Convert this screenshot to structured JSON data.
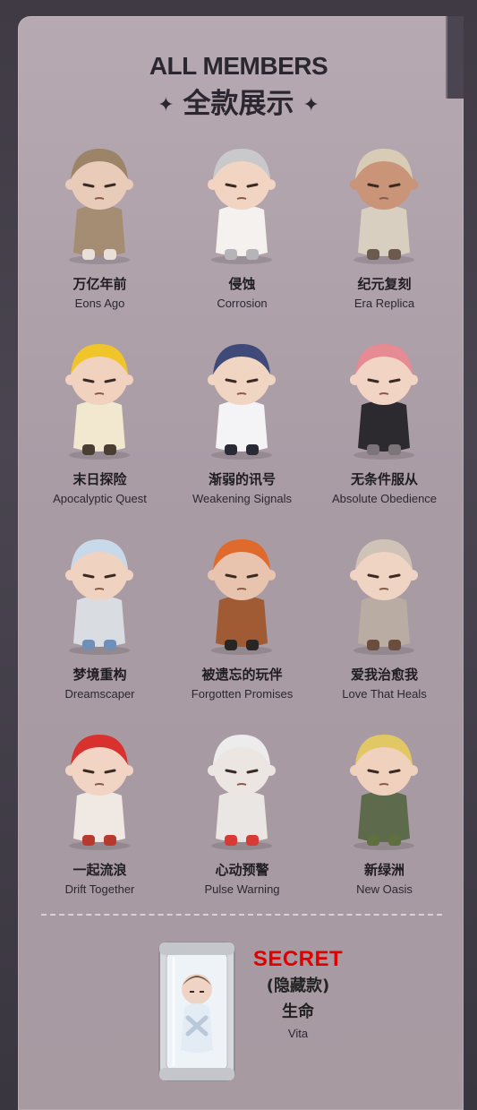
{
  "header": {
    "title_en": "ALL MEMBERS",
    "title_cn": "全款展示",
    "spark": "✦"
  },
  "members": [
    {
      "cn": "万亿年前",
      "en": "Eons Ago",
      "hair": "#9b8468",
      "skin": "#e8cbb8",
      "outfit": "#a58d73",
      "accent": "#e8e0d8"
    },
    {
      "cn": "侵蚀",
      "en": "Corrosion",
      "hair": "#c9c9cc",
      "skin": "#f1d4c2",
      "outfit": "#f4f1ee",
      "accent": "#b5b5b8"
    },
    {
      "cn": "纪元复刻",
      "en": "Era Replica",
      "hair": "#d8ccb6",
      "skin": "#c99477",
      "outfit": "#d9cfc0",
      "accent": "#6c5a4f"
    },
    {
      "cn": "末日探险",
      "en": "Apocalyptic Quest",
      "hair": "#f0c52a",
      "skin": "#f0d2bf",
      "outfit": "#f2e7cf",
      "accent": "#4a3d32"
    },
    {
      "cn": "渐弱的讯号",
      "en": "Weakening Signals",
      "hair": "#3f4a78",
      "skin": "#f0d5c3",
      "outfit": "#f4f4f6",
      "accent": "#2a2a34"
    },
    {
      "cn": "无条件服从",
      "en": "Absolute Obedience",
      "hair": "#e68a93",
      "skin": "#f2d4c4",
      "outfit": "#2c2a2e",
      "accent": "#7b7479"
    },
    {
      "cn": "梦境重构",
      "en": "Dreamscaper",
      "hair": "#c8d9ea",
      "skin": "#f0d2c0",
      "outfit": "#d9dde2",
      "accent": "#6f8fb6"
    },
    {
      "cn": "被遗忘的玩伴",
      "en": "Forgotten Promises",
      "hair": "#e06a2c",
      "skin": "#e8c4ae",
      "outfit": "#a05a34",
      "accent": "#2a2624"
    },
    {
      "cn": "爱我治愈我",
      "en": "Love That Heals",
      "hair": "#cfc2b7",
      "skin": "#efd3c3",
      "outfit": "#b9aca2",
      "accent": "#6a4d3d"
    },
    {
      "cn": "一起流浪",
      "en": "Drift Together",
      "hair": "#d9322e",
      "skin": "#f1d4c4",
      "outfit": "#f0e9e3",
      "accent": "#b83a2f"
    },
    {
      "cn": "心动预警",
      "en": "Pulse Warning",
      "hair": "#ececec",
      "skin": "#ece6e2",
      "outfit": "#e9e6e4",
      "accent": "#d83b35"
    },
    {
      "cn": "新绿洲",
      "en": "New Oasis",
      "hair": "#e2c864",
      "skin": "#efd1be",
      "outfit": "#5d6a4c",
      "accent": "#5f6f3e"
    }
  ],
  "secret": {
    "label": "SECRET",
    "sub": "(隐藏款)",
    "cn": "生命",
    "en": "Vita"
  }
}
